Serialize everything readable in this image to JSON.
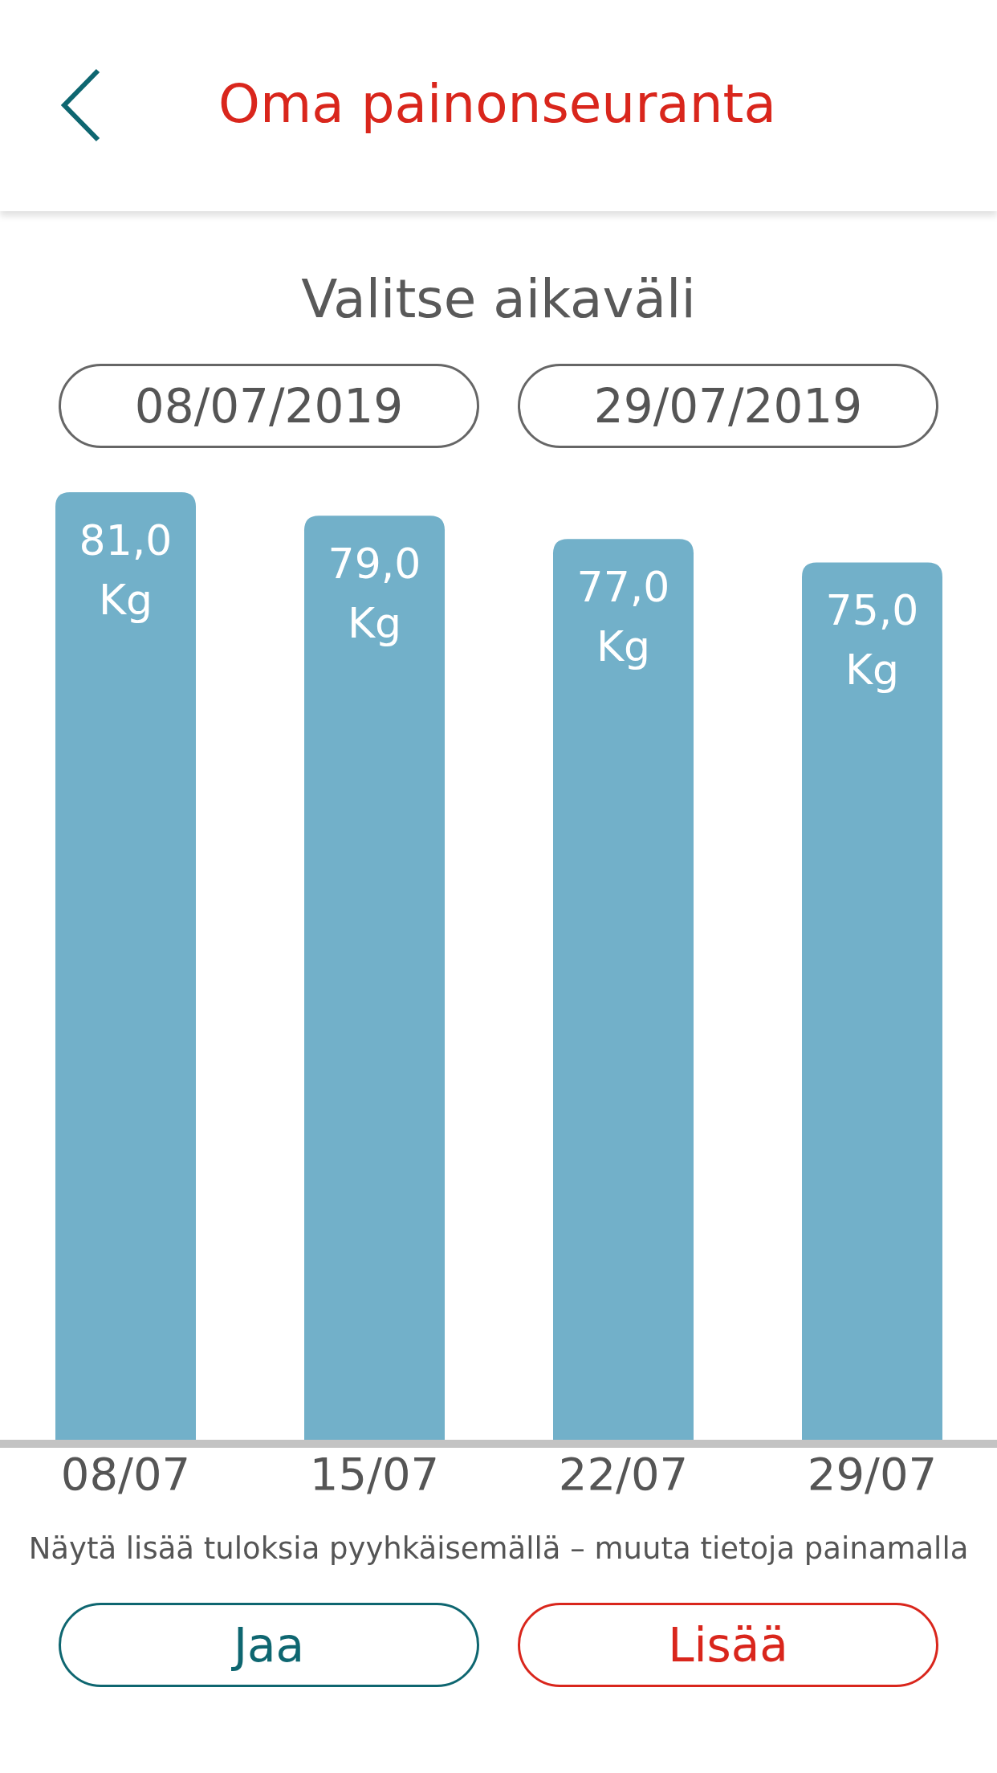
{
  "header": {
    "title": "Oma painonseuranta"
  },
  "range": {
    "title": "Valitse aikaväli",
    "start_date": "08/07/2019",
    "end_date": "29/07/2019"
  },
  "chart_data": {
    "type": "bar",
    "categories": [
      "08/07",
      "15/07",
      "22/07",
      "29/07"
    ],
    "values": [
      81.0,
      79.0,
      77.0,
      75.0
    ],
    "ylim": [
      0,
      81
    ],
    "value_labels": [
      "81,0 Kg",
      "79,0 Kg",
      "77,0 Kg",
      "75,0 Kg"
    ]
  },
  "hint": "Näytä lisää tuloksia pyyhkäisemällä – muuta tietoja painamalla",
  "buttons": [
    {
      "label": "Jaa",
      "kind": "share"
    },
    {
      "label": "Lisää",
      "kind": "add"
    }
  ]
}
